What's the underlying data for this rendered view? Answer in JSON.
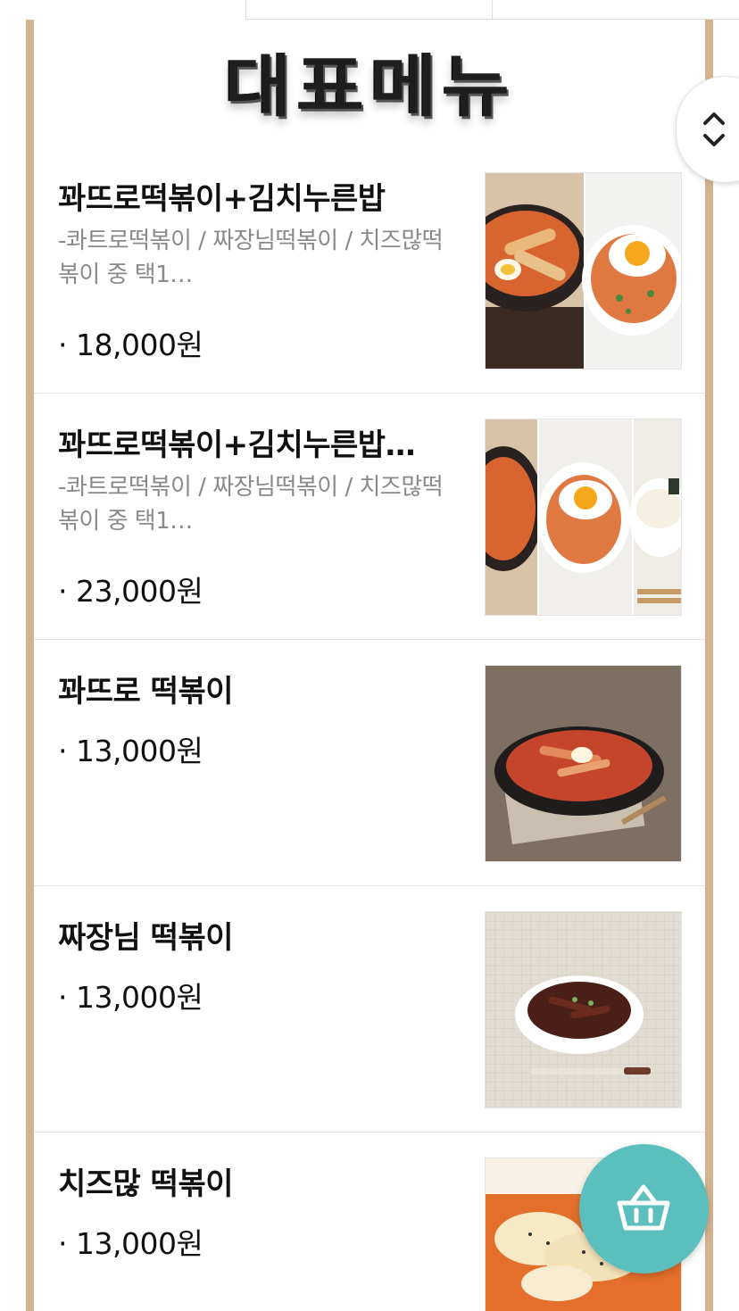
{
  "section": {
    "title": "대표메뉴"
  },
  "menu_items": [
    {
      "name": "꽈뜨로떡볶이+김치누른밥",
      "description": "-콰트로떡볶이 / 짜장님떡볶이 / 치즈많떡볶이 중 택1…",
      "price": "· 18,000원",
      "image": "tteokbokki-and-kimchi-fried-rice-photo"
    },
    {
      "name": "꽈뜨로떡볶이+김치누른밥…",
      "description": "-콰트로떡볶이 / 짜장님떡볶이 / 치즈많떡볶이 중 택1…",
      "price": "· 23,000원",
      "image": "tteokbokki-fried-rice-noodle-set-photo"
    },
    {
      "name": "꽈뜨로 떡볶이",
      "description": "",
      "price": "· 13,000원",
      "image": "tteokbokki-pan-photo"
    },
    {
      "name": "짜장님 떡볶이",
      "description": "",
      "price": "· 13,000원",
      "image": "jjajang-tteokbokki-bowl-photo"
    },
    {
      "name": "치즈많 떡볶이",
      "description": "",
      "price": "· 13,000원",
      "image": "cheese-tteokbokki-photo"
    }
  ],
  "icons": {
    "scroll": "chevron-up-down-icon",
    "cart": "basket-icon"
  },
  "colors": {
    "frame": "#d4b48e",
    "cart_button": "#5bbfbe",
    "description_text": "#8a8a8a"
  }
}
